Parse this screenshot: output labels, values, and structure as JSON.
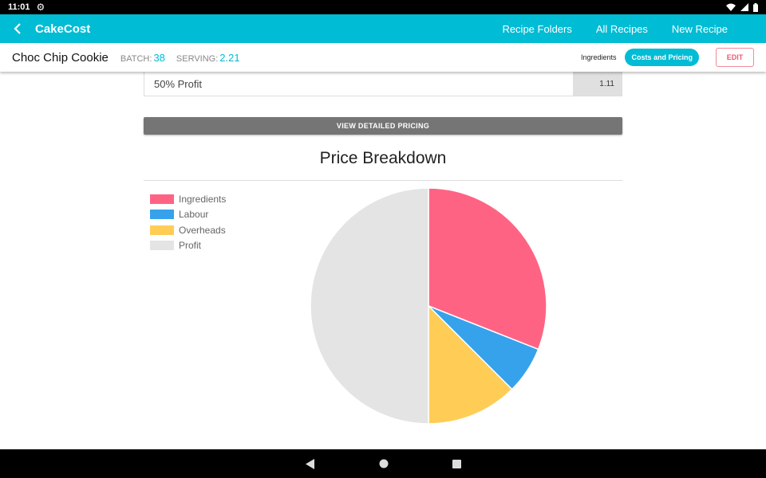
{
  "status_bar": {
    "time": "11:01"
  },
  "app_bar": {
    "title": "CakeCost",
    "nav": [
      "Recipe Folders",
      "All Recipes",
      "New Recipe"
    ]
  },
  "recipe": {
    "name": "Choc Chip Cookie",
    "batch_label": "BATCH:",
    "batch_value": "38",
    "serving_label": "SERVING:",
    "serving_value": "2.21"
  },
  "tabs": {
    "ingredients": "Ingredients",
    "costs": "Costs and Pricing",
    "edit": "EDIT"
  },
  "profit_row": {
    "label": "50% Profit",
    "value": "1.11"
  },
  "detail_button": "VIEW DETAILED PRICING",
  "chart_data": {
    "type": "pie",
    "title": "Price Breakdown",
    "categories": [
      "Ingredients",
      "Labour",
      "Overheads",
      "Profit"
    ],
    "values": [
      31,
      6.5,
      12.5,
      50
    ],
    "colors": [
      "#ff6384",
      "#36a2eb",
      "#ffcd56",
      "#e4e4e4"
    ],
    "legend_position": "top-left"
  },
  "colors": {
    "accent": "#00bcd4",
    "edit": "#f05a70",
    "button_gray": "#757575"
  },
  "icons": {
    "back": "arrow-back-icon",
    "settings": "gear-icon",
    "wifi": "wifi-icon",
    "signal": "signal-icon",
    "battery": "battery-icon"
  }
}
